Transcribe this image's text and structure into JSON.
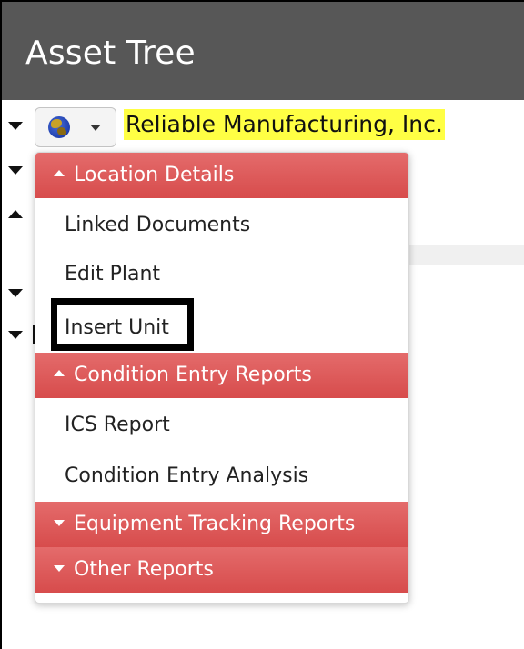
{
  "header": {
    "title": "Asset Tree"
  },
  "tree": {
    "company_name": "Reliable Manufacturing, Inc.",
    "location_icon": "globe-icon",
    "highlight_color": "#ffff44"
  },
  "menu": {
    "accent_color": "#d74c4c",
    "sections": [
      {
        "label": "Location Details",
        "state": "expanded",
        "items": [
          "Linked Documents",
          "Edit Plant",
          "Insert Unit"
        ]
      },
      {
        "label": "Condition Entry Reports",
        "state": "expanded",
        "items": [
          "ICS Report",
          "Condition Entry Analysis"
        ]
      },
      {
        "label": "Equipment Tracking Reports",
        "state": "collapsed",
        "items": []
      },
      {
        "label": "Other Reports",
        "state": "collapsed",
        "items": []
      }
    ]
  }
}
